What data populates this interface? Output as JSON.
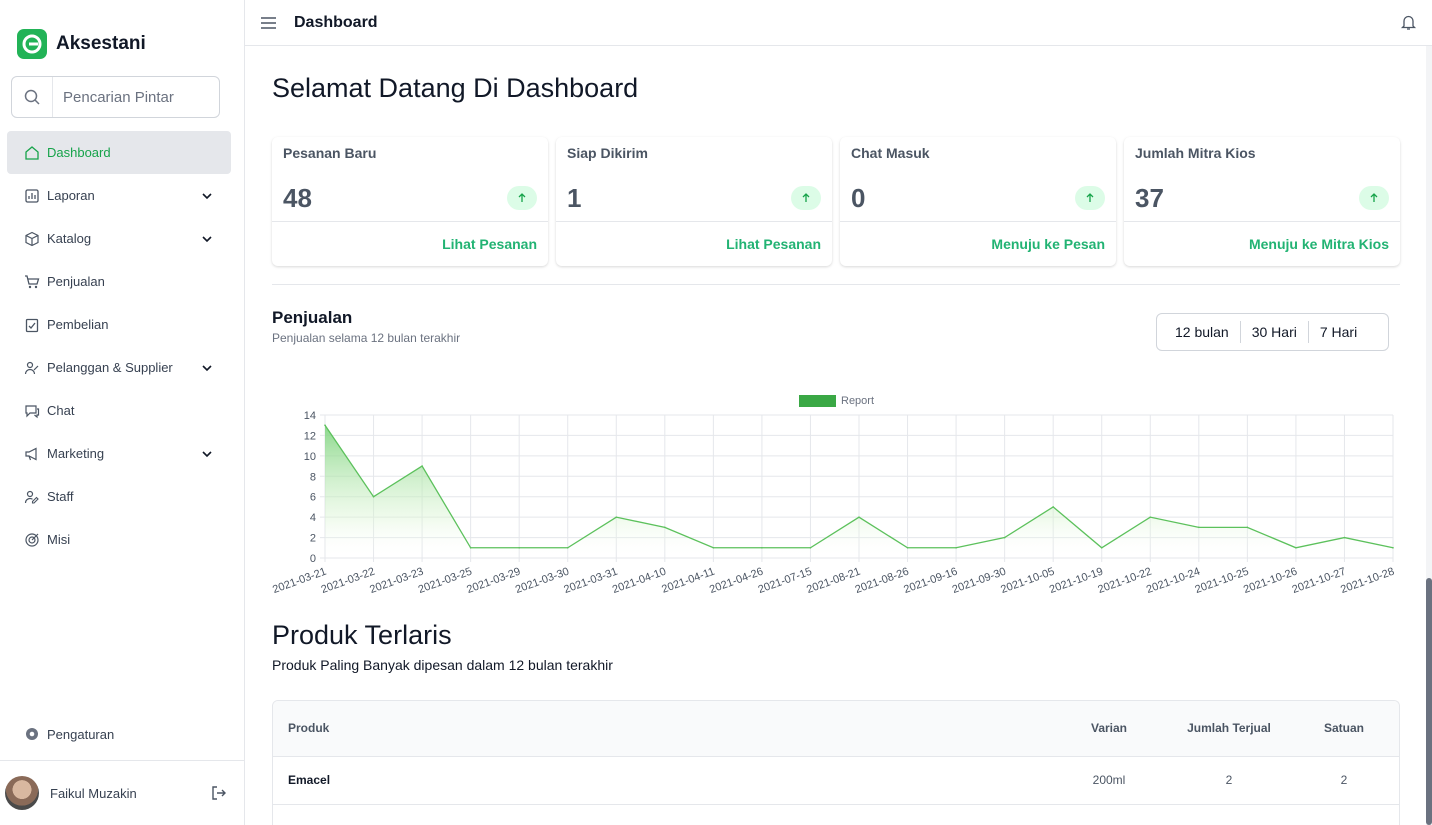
{
  "app": {
    "name": "Aksestani"
  },
  "search": {
    "placeholder": "Pencarian Pintar"
  },
  "sidebar": {
    "items": [
      {
        "label": "Dashboard",
        "icon": "home-icon",
        "active": true,
        "expandable": false
      },
      {
        "label": "Laporan",
        "icon": "report-icon",
        "expandable": true
      },
      {
        "label": "Katalog",
        "icon": "cube-icon",
        "expandable": true
      },
      {
        "label": "Penjualan",
        "icon": "cart-icon",
        "expandable": false
      },
      {
        "label": "Pembelian",
        "icon": "clipboard-check-icon",
        "expandable": false
      },
      {
        "label": "Pelanggan & Supplier",
        "icon": "users-icon",
        "expandable": true
      },
      {
        "label": "Chat",
        "icon": "chat-icon",
        "expandable": false
      },
      {
        "label": "Marketing",
        "icon": "megaphone-icon",
        "expandable": true
      },
      {
        "label": "Staff",
        "icon": "user-edit-icon",
        "expandable": false
      },
      {
        "label": "Misi",
        "icon": "target-icon",
        "expandable": false
      }
    ],
    "settings_label": "Pengaturan",
    "user": {
      "name": "Faikul Muzakin"
    }
  },
  "header": {
    "title": "Dashboard"
  },
  "main": {
    "welcome": "Selamat Datang Di Dashboard",
    "stats": [
      {
        "label": "Pesanan Baru",
        "value": "48",
        "link": "Lihat Pesanan"
      },
      {
        "label": "Siap Dikirim",
        "value": "1",
        "link": "Lihat Pesanan"
      },
      {
        "label": "Chat Masuk",
        "value": "0",
        "link": "Menuju ke Pesan"
      },
      {
        "label": "Jumlah Mitra Kios",
        "value": "37",
        "link": "Menuju ke Mitra Kios"
      }
    ],
    "sales": {
      "title": "Penjualan",
      "subtitle": "Penjualan selama 12 bulan terakhir",
      "ranges": [
        "12 bulan",
        "30 Hari",
        "7 Hari"
      ]
    },
    "products": {
      "title": "Produk Terlaris",
      "subtitle": "Produk Paling Banyak dipesan dalam 12 bulan terakhir",
      "columns": [
        "Produk",
        "Varian",
        "Jumlah Terjual",
        "Satuan"
      ],
      "rows": [
        {
          "produk": "Emacel",
          "varian": "200ml",
          "jumlah": "2",
          "satuan": "2"
        }
      ]
    }
  },
  "colors": {
    "accent": "#22b373",
    "brand": "#22b357",
    "line": "#5cc15c"
  },
  "chart_data": {
    "type": "area",
    "legend": [
      "Report"
    ],
    "legend_position": "top-center",
    "grid": true,
    "ylim": [
      0,
      14
    ],
    "yticks": [
      0,
      2,
      4,
      6,
      8,
      10,
      12,
      14
    ],
    "x": [
      "2021-03-21",
      "2021-03-22",
      "2021-03-23",
      "2021-03-25",
      "2021-03-29",
      "2021-03-30",
      "2021-03-31",
      "2021-04-10",
      "2021-04-11",
      "2021-04-26",
      "2021-07-15",
      "2021-08-21",
      "2021-08-26",
      "2021-09-16",
      "2021-09-30",
      "2021-10-05",
      "2021-10-19",
      "2021-10-22",
      "2021-10-24",
      "2021-10-25",
      "2021-10-26",
      "2021-10-27",
      "2021-10-28"
    ],
    "series": [
      {
        "name": "Report",
        "values": [
          13,
          6,
          9,
          1,
          1,
          1,
          4,
          3,
          1,
          1,
          1,
          4,
          1,
          1,
          2,
          5,
          1,
          4,
          3,
          3,
          1,
          2,
          1
        ]
      }
    ]
  }
}
